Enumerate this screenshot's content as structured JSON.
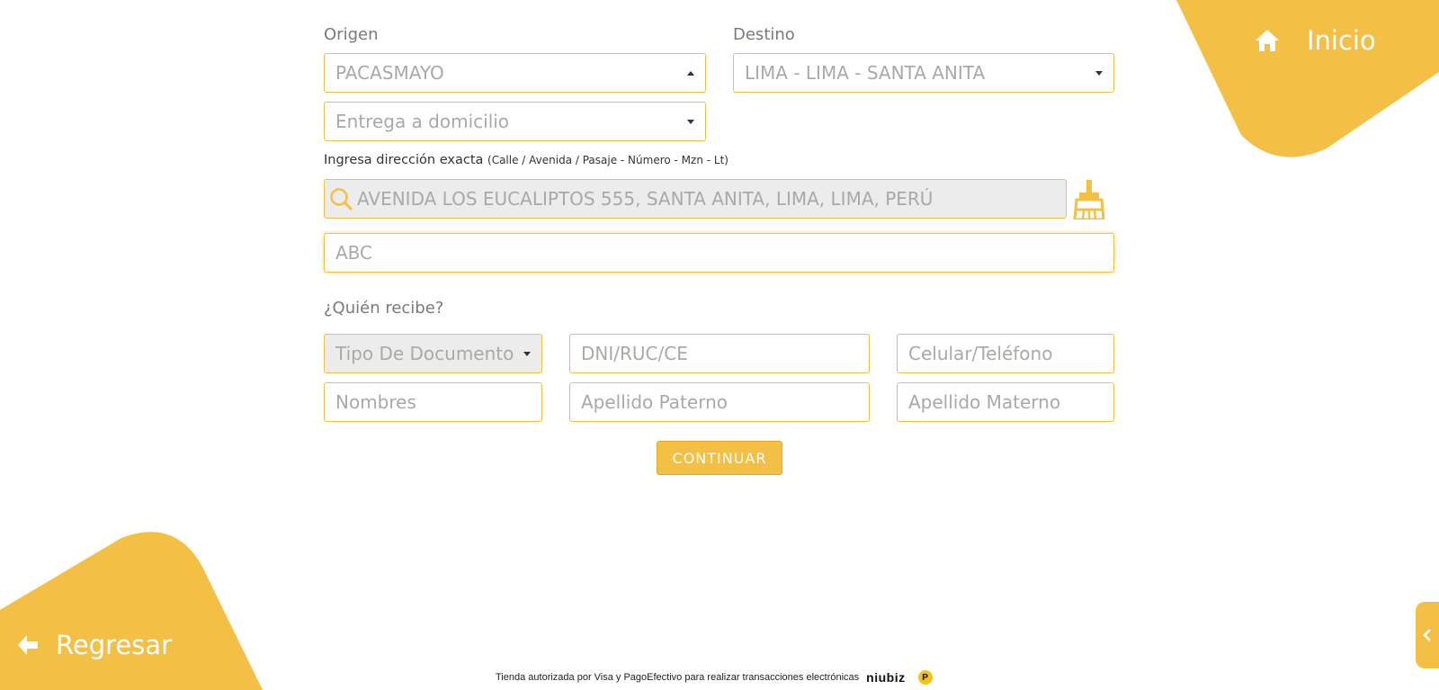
{
  "nav": {
    "home_label": "Inicio",
    "back_label": "Regresar"
  },
  "origin": {
    "label": "Origen",
    "value": "PACASMAYO",
    "delivery_value": "Entrega a domicilio"
  },
  "destination": {
    "label": "Destino",
    "value": "LIMA - LIMA - SANTA ANITA"
  },
  "address": {
    "hint": "Ingresa dirección exacta",
    "hint_detail": "(Calle / Avenida / Pasaje - Número - Mzn - Lt)",
    "search_value": "AVENIDA LOS EUCALIPTOS 555, SANTA ANITA, LIMA, LIMA, PERÚ",
    "reference_value": "ABC"
  },
  "receiver": {
    "label": "¿Quién recibe?",
    "doc_type_placeholder": "Tipo De Documento",
    "doc_number_placeholder": "DNI/RUC/CE",
    "phone_placeholder": "Celular/Teléfono",
    "names_placeholder": "Nombres",
    "paternal_placeholder": "Apellido Paterno",
    "maternal_placeholder": "Apellido Materno"
  },
  "actions": {
    "continue_label": "CONTINUAR"
  },
  "footer": {
    "text": "Tienda autorizada por Visa y PagoEfectivo para realizar transacciones electrónicas",
    "niubiz_logo": "niubiz",
    "pagoefectivo_logo": "P"
  },
  "colors": {
    "accent": "#f4bf45"
  }
}
